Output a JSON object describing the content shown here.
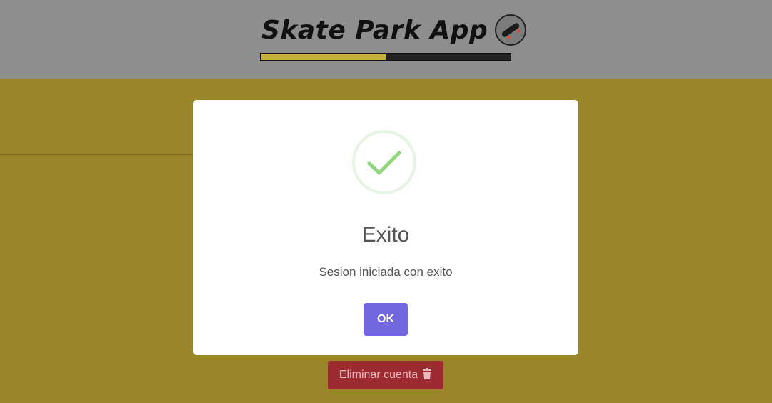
{
  "header": {
    "app_title": "Skate Park App",
    "logo_icon": "skateboard-icon",
    "progress_fraction": 0.5
  },
  "page": {
    "delete_button_label": "Eliminar cuenta",
    "delete_icon": "trash-icon"
  },
  "modal": {
    "icon": "success-checkmark-icon",
    "title": "Exito",
    "message": "Sesion iniciada con exito",
    "confirm_label": "OK"
  },
  "colors": {
    "page_bg": "#9a8629",
    "header_bg": "#8e8e8e",
    "progress_fill": "#c7b23e",
    "confirm_button": "#7367e0",
    "delete_button": "#9e2a31",
    "success_green": "#8fd67f"
  }
}
